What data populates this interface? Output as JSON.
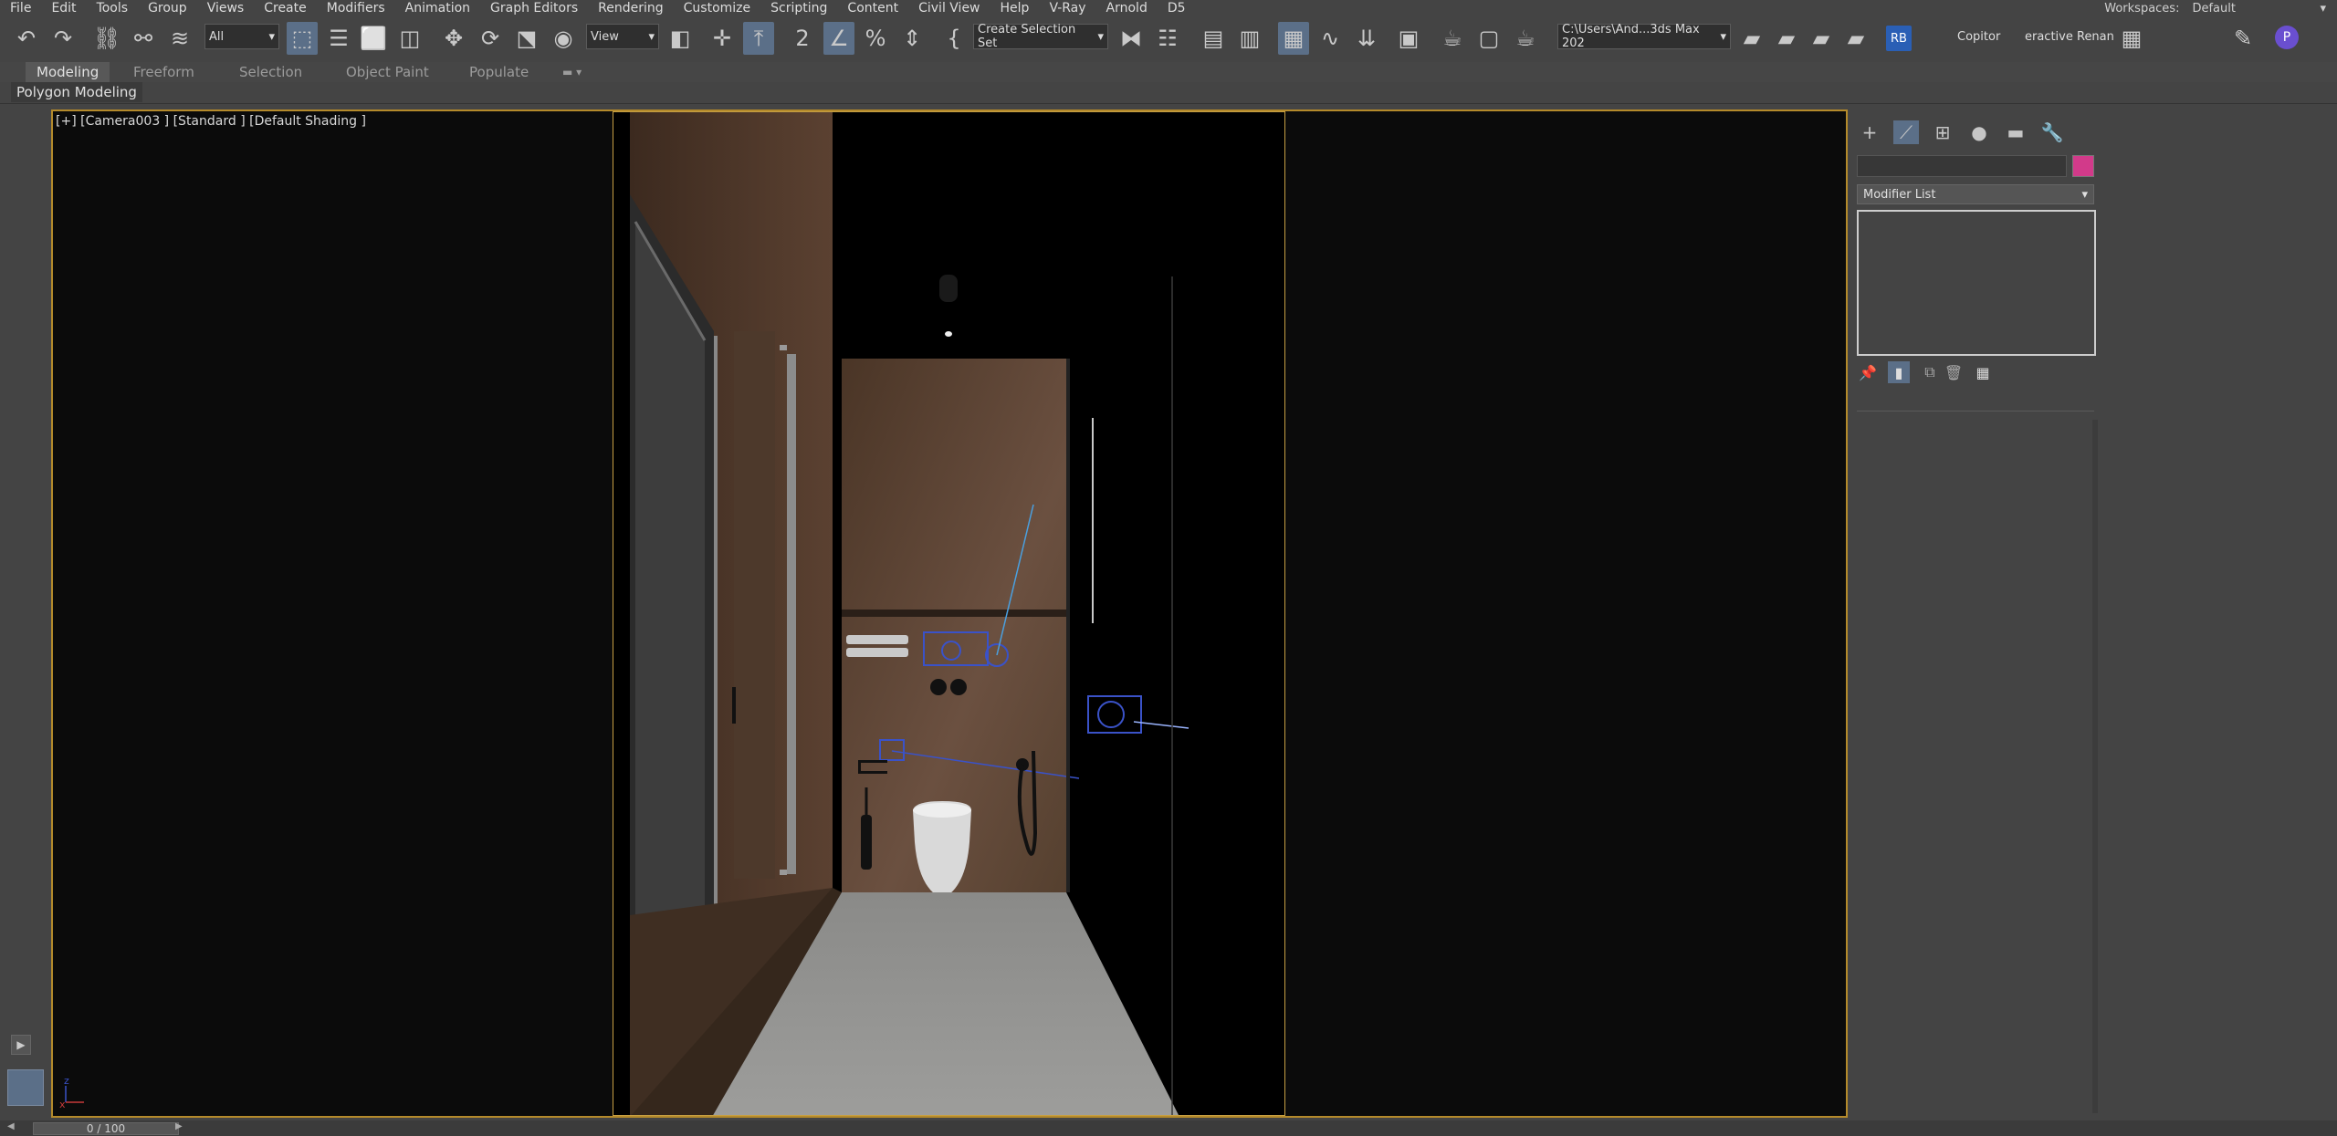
{
  "menu": [
    "File",
    "Edit",
    "Tools",
    "Group",
    "Views",
    "Create",
    "Modifiers",
    "Animation",
    "Graph Editors",
    "Rendering",
    "Customize",
    "Scripting",
    "Content",
    "Civil View",
    "Help",
    "V-Ray",
    "Arnold",
    "D5"
  ],
  "workspace": {
    "label": "Workspaces:",
    "value": "Default"
  },
  "toolbar": {
    "selection_filter": "All",
    "ref_coord": "View",
    "selection_set": "Create Selection Set",
    "project_path": "C:\\Users\\And...3ds Max 202",
    "rb_badge": "RB",
    "copitor": "Copitor",
    "interactive": "eractive Renan"
  },
  "ribbon": {
    "tabs": [
      "Modeling",
      "Freeform",
      "Selection",
      "Object Paint",
      "Populate"
    ],
    "active_tab": "Modeling",
    "sub_label": "Polygon Modeling"
  },
  "viewport": {
    "label": "[+] [Camera003 ] [Standard ] [Default Shading ]"
  },
  "command_panel": {
    "modifier_list": "Modifier List",
    "swatch_color": "#d23a8a"
  },
  "timeline": {
    "frame": "0 / 100"
  },
  "colors": {
    "accent": "#5b6f88",
    "viewport_border": "#b48a2b"
  }
}
